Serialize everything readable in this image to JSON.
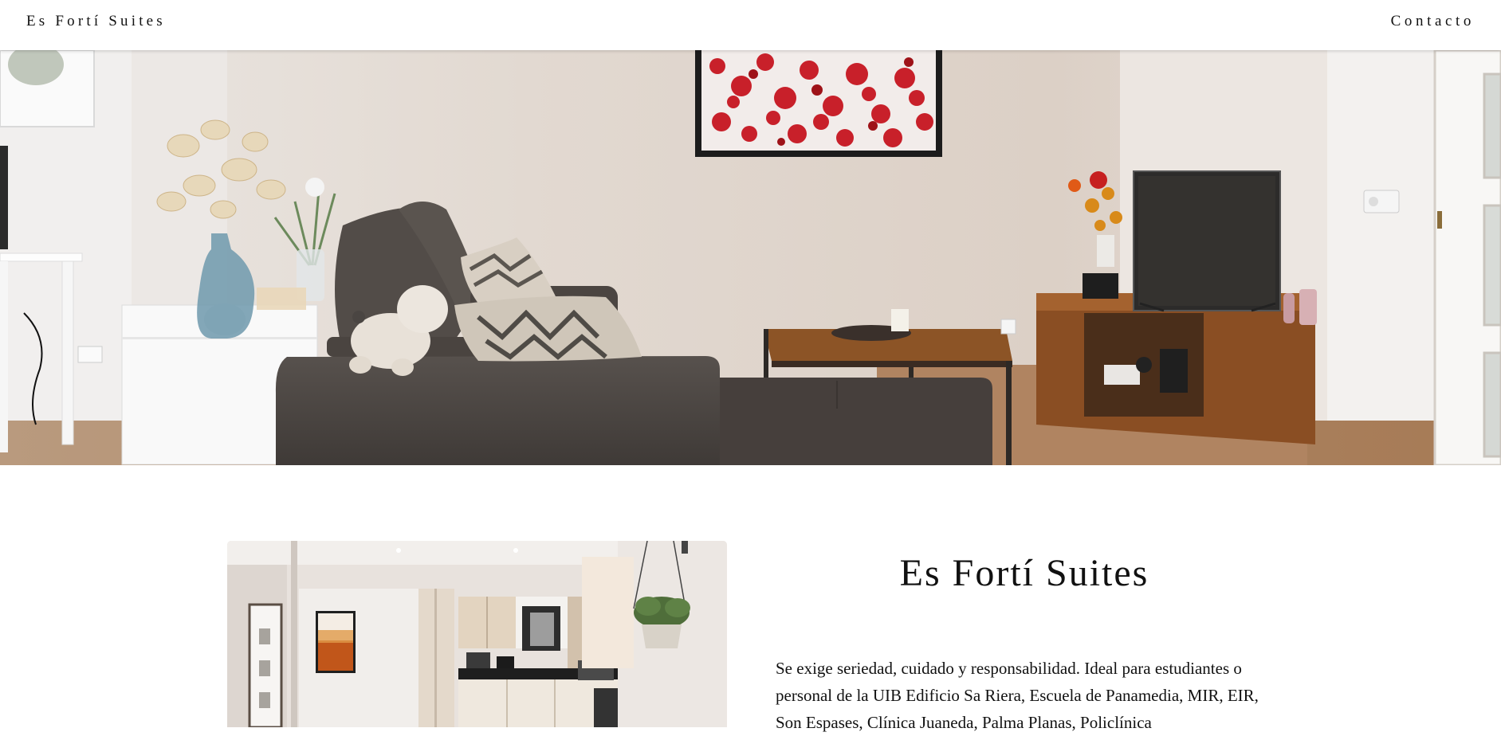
{
  "header": {
    "site_title": "Es Fortí Suites",
    "nav_contact": "Contacto"
  },
  "hero": {
    "image_alt": "Living room with grey sofa, wooden coffee table, TV stand and red abstract painting"
  },
  "about": {
    "image_alt": "Kitchen viewed from the living area with hanging plant",
    "heading": "Es Fortí Suites",
    "text": "Se exige seriedad, cuidado y responsabilidad. Ideal para estudiantes o personal de la UIB Edificio Sa Riera, Escuela de Panamedia, MIR, EIR, Son Espases, Clínica Juaneda, Palma Planas, Policlínica"
  },
  "colors": {
    "header_bg": "#ffffff",
    "text": "#111111",
    "wall": "#ddd3c9",
    "sofa": "#4a4542",
    "wood": "#8a4e23",
    "painting_red": "#c8202a"
  }
}
